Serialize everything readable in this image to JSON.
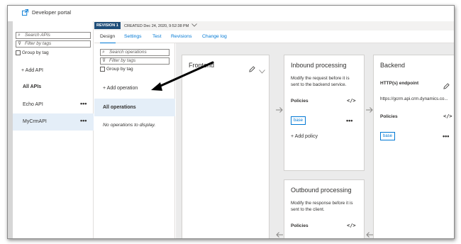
{
  "header": {
    "portal_link": "Developer portal"
  },
  "api_list": {
    "search_placeholder": "Search APIs",
    "filter_placeholder": "Filter by tags",
    "group_by_tag": "Group by tag",
    "add_api": "+ Add API",
    "all_apis": "All APIs",
    "items": [
      {
        "name": "Echo API",
        "menu": "•••",
        "selected": false
      },
      {
        "name": "MyCrmAPI",
        "menu": "•••",
        "selected": true
      }
    ]
  },
  "revision": {
    "badge": "REVISION 1",
    "created": "CREATED Dec 24, 2020, 9:52:38 PM"
  },
  "tabs": [
    {
      "label": "Design",
      "active": true
    },
    {
      "label": "Settings",
      "active": false
    },
    {
      "label": "Test",
      "active": false
    },
    {
      "label": "Revisions",
      "active": false
    },
    {
      "label": "Change log",
      "active": false
    }
  ],
  "operations": {
    "search_placeholder": "Search operations",
    "filter_placeholder": "Filter by tags",
    "group_by_tag": "Group by tag",
    "add_operation": "+ Add operation",
    "all_operations": "All operations",
    "empty_message": "No operations to display."
  },
  "frontend": {
    "title": "Frontend"
  },
  "inbound": {
    "title": "Inbound processing",
    "description_line1": "Modify the request before it is",
    "description_line2": "sent to the backend service.",
    "policies_label": "Policies",
    "code_icon": "</>",
    "base_tag": "base",
    "menu": "•••",
    "add_policy": "+ Add policy"
  },
  "outbound": {
    "title": "Outbound processing",
    "description_line1": "Modify the response before it is",
    "description_line2": "sent to the client.",
    "policies_label": "Policies",
    "code_icon": "</>"
  },
  "backend": {
    "title": "Backend",
    "endpoint_label": "HTTP(s) endpoint",
    "endpoint_url": "https://gcrm.api.crm.dynamics.co...",
    "policies_label": "Policies",
    "code_icon": "</>",
    "base_tag": "base",
    "menu": "•••"
  },
  "colors": {
    "accent": "#0078d4",
    "selected_row": "#e4eef8",
    "revision_badge": "#1f4e79",
    "design_bg": "#ebebeb"
  },
  "icons": [
    "external-link-icon",
    "search-icon",
    "filter-icon",
    "chevron-down-icon",
    "edit-pencil-icon",
    "code-icon",
    "arrow-right-icon",
    "arrow-left-icon",
    "callout-arrow-icon"
  ]
}
